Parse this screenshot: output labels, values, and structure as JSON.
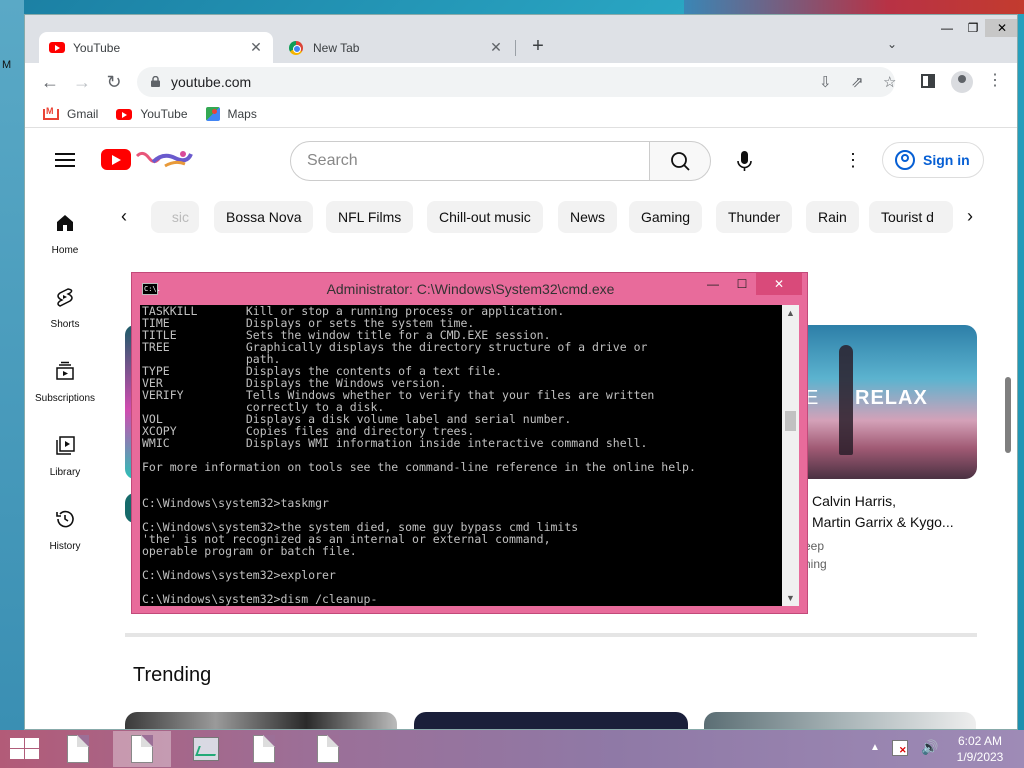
{
  "desktop": {
    "label": "M"
  },
  "browser": {
    "tabs": [
      {
        "title": "YouTube",
        "icon": "youtube-icon"
      },
      {
        "title": "New Tab",
        "icon": "chrome-icon"
      }
    ],
    "new_tab_symbol": "+",
    "tab_menu_symbol": "⌄",
    "window_controls": {
      "minimize": "—",
      "maximize": "❐",
      "close": "✕"
    },
    "nav": {
      "back": "←",
      "forward": "→",
      "reload": "↻"
    },
    "url": "youtube.com",
    "toolbar_icons": {
      "install": "⇩",
      "share": "⇗",
      "star": "☆",
      "menu": "⋮"
    },
    "bookmarks": [
      {
        "label": "Gmail",
        "icon": "gmail-icon"
      },
      {
        "label": "YouTube",
        "icon": "youtube-icon"
      },
      {
        "label": "Maps",
        "icon": "maps-icon"
      }
    ]
  },
  "youtube": {
    "search_placeholder": "Search",
    "more_symbol": "⋮",
    "sign_in_label": "Sign in",
    "guide": [
      {
        "label": "Home",
        "icon": "home-icon"
      },
      {
        "label": "Shorts",
        "icon": "shorts-icon"
      },
      {
        "label": "Subscriptions",
        "icon": "subscriptions-icon"
      },
      {
        "label": "Library",
        "icon": "library-icon"
      },
      {
        "label": "History",
        "icon": "history-icon"
      }
    ],
    "chips_prev": "‹",
    "chips_next": "›",
    "chips": [
      "sic",
      "Bossa Nova",
      "NFL Films",
      "Chill-out music",
      "News",
      "Gaming",
      "Thunder",
      "Rain",
      "Tourist d"
    ],
    "video": {
      "thumb_text": "RELAX",
      "thumb_text_left": "E",
      "title_lines": [
        "Calvin Harris,",
        "Martin Garrix & Kygo..."
      ],
      "channel_lines": [
        "eep",
        "ning"
      ]
    },
    "trending_heading": "Trending"
  },
  "cmd": {
    "icon_text": "C:\\.",
    "title": "Administrator: C:\\Windows\\System32\\cmd.exe",
    "window_controls": {
      "minimize": "—",
      "maximize": "☐",
      "close": "✕"
    },
    "scroll_up": "▲",
    "scroll_down": "▼",
    "lines": [
      "TASKKILL       Kill or stop a running process or application.",
      "TIME           Displays or sets the system time.",
      "TITLE          Sets the window title for a CMD.EXE session.",
      "TREE           Graphically displays the directory structure of a drive or",
      "               path.",
      "TYPE           Displays the contents of a text file.",
      "VER            Displays the Windows version.",
      "VERIFY         Tells Windows whether to verify that your files are written",
      "               correctly to a disk.",
      "VOL            Displays a disk volume label and serial number.",
      "XCOPY          Copies files and directory trees.",
      "WMIC           Displays WMI information inside interactive command shell.",
      "",
      "For more information on tools see the command-line reference in the online help.",
      "",
      "",
      "C:\\Windows\\system32>taskmgr",
      "",
      "C:\\Windows\\system32>the system died, some guy bypass cmd limits",
      "'the' is not recognized as an internal or external command,",
      "operable program or batch file.",
      "",
      "C:\\Windows\\system32>explorer",
      "",
      "C:\\Windows\\system32>dism /cleanup-"
    ]
  },
  "taskbar": {
    "items": [
      {
        "icon": "document-icon",
        "active": false
      },
      {
        "icon": "document-icon",
        "active": true
      },
      {
        "icon": "task-manager-icon",
        "active": false
      },
      {
        "icon": "document-icon",
        "active": false
      },
      {
        "icon": "document-icon",
        "active": false
      }
    ],
    "tray_up_symbol": "▲",
    "volume_symbol": "🔊",
    "time": "6:02 AM",
    "date": "1/9/2023"
  },
  "colors": {
    "youtube_red": "#ff0000",
    "signin_blue": "#065fd4",
    "cmd_frame": "#e86b9b"
  }
}
